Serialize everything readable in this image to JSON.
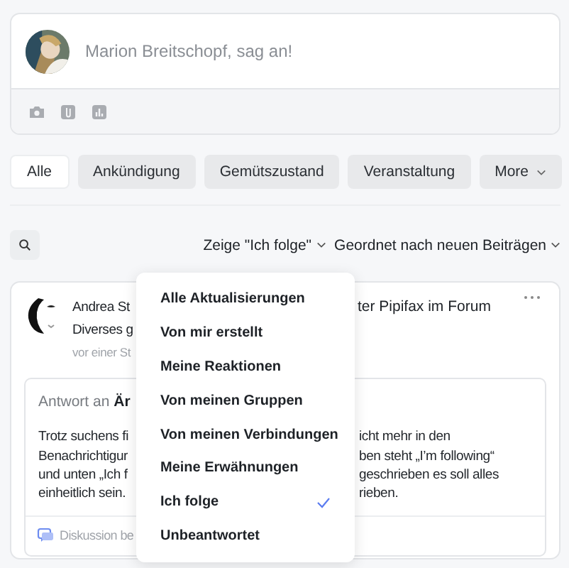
{
  "composer": {
    "placeholder": "Marion Breitschopf, sag an!"
  },
  "filters": [
    {
      "label": "Alle",
      "selected": true,
      "kind": "tab"
    },
    {
      "label": "Ankündigung",
      "selected": false,
      "kind": "tab"
    },
    {
      "label": "Gemütszustand",
      "selected": false,
      "kind": "tab"
    },
    {
      "label": "Veranstaltung",
      "selected": false,
      "kind": "tab"
    },
    {
      "label": "More",
      "selected": false,
      "kind": "menu"
    }
  ],
  "feed_controls": {
    "show_filter": "Zeige \"Ich folge\"",
    "sort": "Geordnet nach neuen Beiträgen"
  },
  "post": {
    "header": [
      {
        "left": "Andrea St",
        "right": "ter Pipifax im Forum"
      },
      {
        "left": "Diverses g"
      },
      {
        "left": "vor einer St"
      }
    ],
    "reply": {
      "heading": "Antwort an **Är**",
      "lines": [
        {
          "left": "Trotz suchens fi",
          "right": "icht mehr in den"
        },
        {
          "left": "Benachrichtigur",
          "right": "ben steht „I’m following“"
        },
        {
          "left": "und unten „Ich f",
          "right": "geschrieben es soll alles"
        },
        {
          "left": "einheitlich sein.",
          "right": "rieben."
        }
      ],
      "footer": "Diskussion be"
    }
  },
  "dropdown": {
    "items": [
      {
        "label": "Alle Aktualisierungen",
        "selected": false
      },
      {
        "label": "Von mir erstellt",
        "selected": false
      },
      {
        "label": "Meine Reaktionen",
        "selected": false
      },
      {
        "label": "Von meinen Gruppen",
        "selected": false
      },
      {
        "label": "Von meinen Verbindungen",
        "selected": false
      },
      {
        "label": "Meine Erwähnungen",
        "selected": false
      },
      {
        "label": "Ich folge",
        "selected": true
      },
      {
        "label": "Unbeantwortet",
        "selected": false
      }
    ]
  }
}
